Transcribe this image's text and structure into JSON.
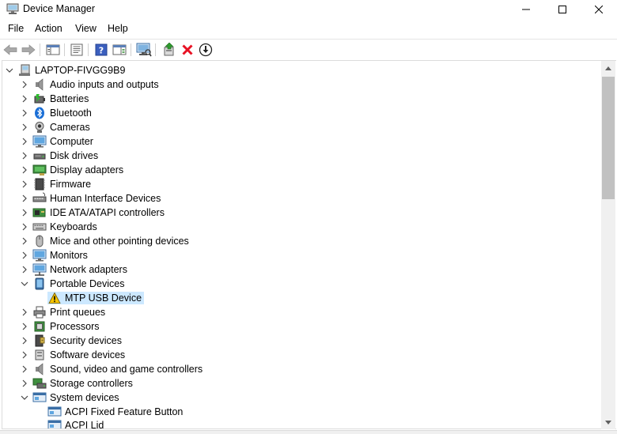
{
  "window": {
    "title": "Device Manager",
    "controls": [
      "minimize",
      "maximize",
      "close"
    ]
  },
  "menu": {
    "file": "File",
    "action": "Action",
    "view": "View",
    "help": "Help"
  },
  "toolbar": {
    "buttons": [
      "back-icon",
      "forward-icon",
      "show-hide-console-tree-icon",
      "properties-icon",
      "help-icon",
      "action-pane-icon",
      "scan-hardware-icon",
      "update-driver-icon",
      "uninstall-icon",
      "disable-device-icon"
    ]
  },
  "tree": {
    "root": "LAPTOP-FIVGG9B9",
    "categories": [
      {
        "label": "Audio inputs and outputs",
        "icon": "speaker-icon",
        "expanded": false
      },
      {
        "label": "Batteries",
        "icon": "battery-icon",
        "expanded": false
      },
      {
        "label": "Bluetooth",
        "icon": "bluetooth-icon",
        "expanded": false
      },
      {
        "label": "Cameras",
        "icon": "camera-icon",
        "expanded": false
      },
      {
        "label": "Computer",
        "icon": "computer-icon",
        "expanded": false
      },
      {
        "label": "Disk drives",
        "icon": "disk-drive-icon",
        "expanded": false
      },
      {
        "label": "Display adapters",
        "icon": "display-adapter-icon",
        "expanded": false
      },
      {
        "label": "Firmware",
        "icon": "firmware-icon",
        "expanded": false
      },
      {
        "label": "Human Interface Devices",
        "icon": "hid-icon",
        "expanded": false
      },
      {
        "label": "IDE ATA/ATAPI controllers",
        "icon": "ide-controller-icon",
        "expanded": false
      },
      {
        "label": "Keyboards",
        "icon": "keyboard-icon",
        "expanded": false
      },
      {
        "label": "Mice and other pointing devices",
        "icon": "mouse-icon",
        "expanded": false
      },
      {
        "label": "Monitors",
        "icon": "monitor-icon",
        "expanded": false
      },
      {
        "label": "Network adapters",
        "icon": "network-adapter-icon",
        "expanded": false
      },
      {
        "label": "Portable Devices",
        "icon": "portable-device-icon",
        "expanded": true,
        "children": [
          {
            "label": "MTP USB Device",
            "icon": "warning-icon",
            "selected": true
          }
        ]
      },
      {
        "label": "Print queues",
        "icon": "printer-icon",
        "expanded": false
      },
      {
        "label": "Processors",
        "icon": "processor-icon",
        "expanded": false
      },
      {
        "label": "Security devices",
        "icon": "security-device-icon",
        "expanded": false
      },
      {
        "label": "Software devices",
        "icon": "software-device-icon",
        "expanded": false
      },
      {
        "label": "Sound, video and game controllers",
        "icon": "sound-controller-icon",
        "expanded": false
      },
      {
        "label": "Storage controllers",
        "icon": "storage-controller-icon",
        "expanded": false
      },
      {
        "label": "System devices",
        "icon": "system-device-icon",
        "expanded": true,
        "children": [
          {
            "label": "ACPI Fixed Feature Button",
            "icon": "system-device-icon"
          },
          {
            "label": "ACPI Lid",
            "icon": "system-device-icon"
          }
        ]
      }
    ]
  },
  "colors": {
    "selection": "#cce8ff",
    "uninstall_red": "#e81123",
    "scan_green": "#2e9a2e"
  }
}
